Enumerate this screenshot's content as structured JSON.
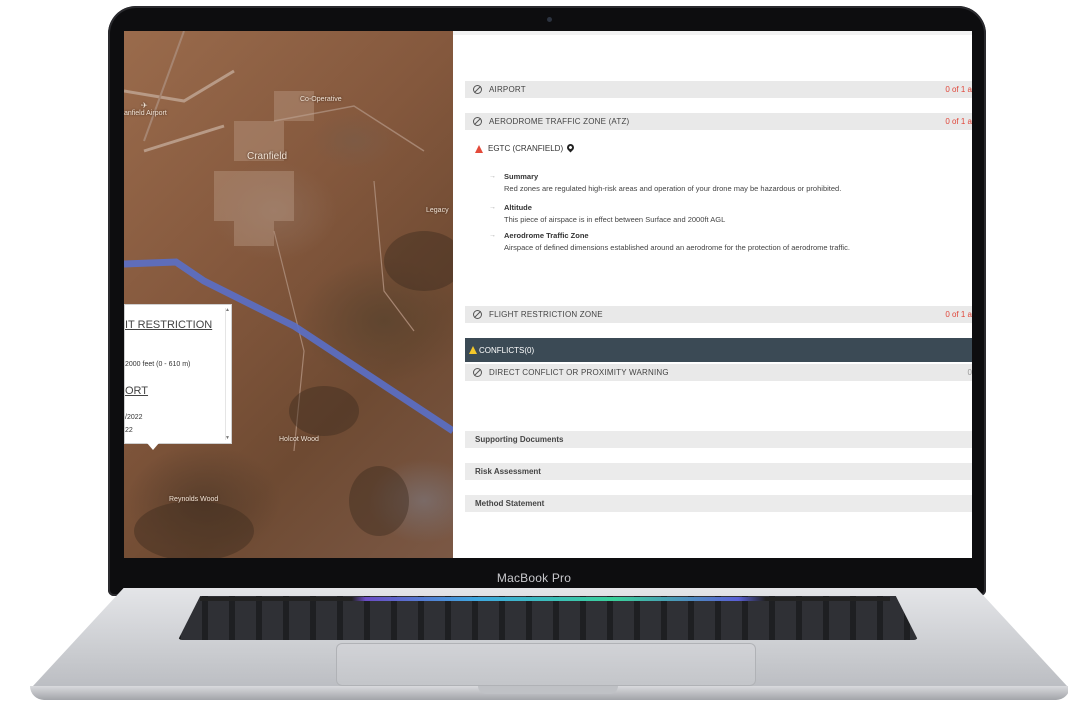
{
  "device": {
    "brand_label": "MacBook Pro"
  },
  "map": {
    "labels": {
      "cranfield_airport": "anfield Airport",
      "co_operative": "Co-Operative",
      "cranfield": "Cranfield",
      "legacy": "Legacy",
      "holcot_wood": "Holcot Wood",
      "reynolds_wood": "Reynolds Wood"
    },
    "popup": {
      "heading1": "IT RESTRICTION",
      "altitude_line": "2000 feet (0 - 610 m)",
      "heading2": "ORT",
      "date1": "/2022",
      "date2": "22"
    }
  },
  "panel": {
    "sections": {
      "airport": {
        "label": "AIRPORT",
        "count": "0 of 1 a"
      },
      "atz": {
        "label": "AERODROME TRAFFIC ZONE (ATZ)",
        "count": "0 of 1 a"
      },
      "frz": {
        "label": "FLIGHT RESTRICTION ZONE",
        "count": "0 of 1 a"
      },
      "direct": {
        "label": "DIRECT CONFLICT OR PROXIMITY WARNING",
        "count": "0"
      }
    },
    "atz_detail": {
      "title": "EGTC (CRANFIELD)",
      "items": [
        {
          "title": "Summary",
          "text": "Red zones are regulated high-risk areas and operation of your drone may be hazardous or prohibited."
        },
        {
          "title": "Altitude",
          "text": "This piece of airspace is in effect between Surface and 2000ft AGL"
        },
        {
          "title": "Aerodrome Traffic Zone",
          "text": "Airspace of defined dimensions established around an aerodrome for the protection of aerodrome traffic."
        }
      ]
    },
    "conflicts_label": "CONFLICTS(0)",
    "documents": [
      "Supporting Documents",
      "Risk Assessment",
      "Method Statement"
    ]
  },
  "colors": {
    "alert_red": "#e0463a",
    "conflict_bar": "#3b4a55",
    "warning_yellow": "#f3c72a",
    "airspace_line": "#5a6fc8"
  }
}
